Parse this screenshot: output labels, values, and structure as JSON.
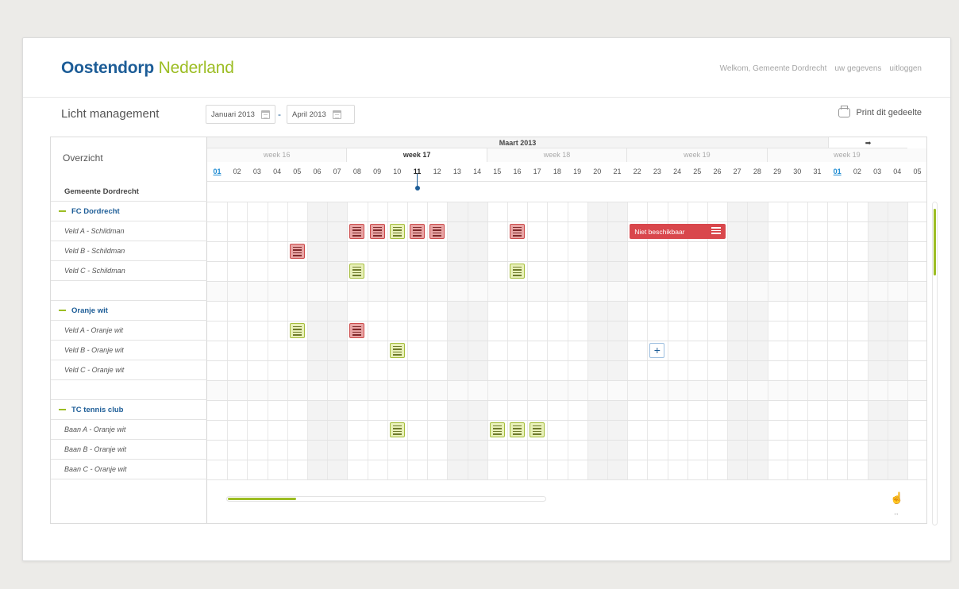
{
  "header": {
    "brand_primary": "Oostendorp",
    "brand_secondary": "Nederland",
    "welcome": "Welkom, Gemeente Dordrecht",
    "account_link": "uw gegevens",
    "logout_link": "uitloggen"
  },
  "toolbar": {
    "title": "Licht management",
    "date_from": "Januari 2013",
    "date_separator": "-",
    "date_to": "April 2013",
    "print_label": "Print dit gedeelte"
  },
  "schedule": {
    "overview_label": "Overzicht",
    "month": "Maart 2013",
    "next_arrow": "➡",
    "weeks": [
      {
        "label": "week 16",
        "current": false
      },
      {
        "label": "week 17",
        "current": true
      },
      {
        "label": "week 18",
        "current": false
      },
      {
        "label": "week 19",
        "current": false
      },
      {
        "label": "week 19",
        "current": false
      }
    ],
    "days": [
      "01",
      "02",
      "03",
      "04",
      "05",
      "06",
      "07",
      "08",
      "09",
      "10",
      "11",
      "12",
      "13",
      "14",
      "15",
      "16",
      "17",
      "18",
      "19",
      "20",
      "21",
      "22",
      "23",
      "24",
      "25",
      "26",
      "27",
      "28",
      "29",
      "30",
      "31",
      "01",
      "02",
      "03",
      "04",
      "05"
    ],
    "organization": "Gemeente Dordrecht",
    "groups": [
      {
        "name": "FC Dordrecht",
        "fields": [
          "Veld A - Schildman",
          "Veld B - Schildman",
          "Veld C - Schildman"
        ]
      },
      {
        "name": "Oranje wit",
        "fields": [
          "Veld A - Oranje wit",
          "Veld B - Oranje wit",
          "Veld C - Oranje wit"
        ]
      },
      {
        "name": "TC tennis club",
        "fields": [
          "Baan A - Oranje wit",
          "Baan B - Oranje wit",
          "Baan C - Oranje wit"
        ]
      }
    ],
    "unavailable_label": "Niet beschikbaar",
    "add_symbol": "+",
    "colors": {
      "red": "#d9474c",
      "green": "#9cbd23",
      "blue": "#1d5d97"
    }
  }
}
